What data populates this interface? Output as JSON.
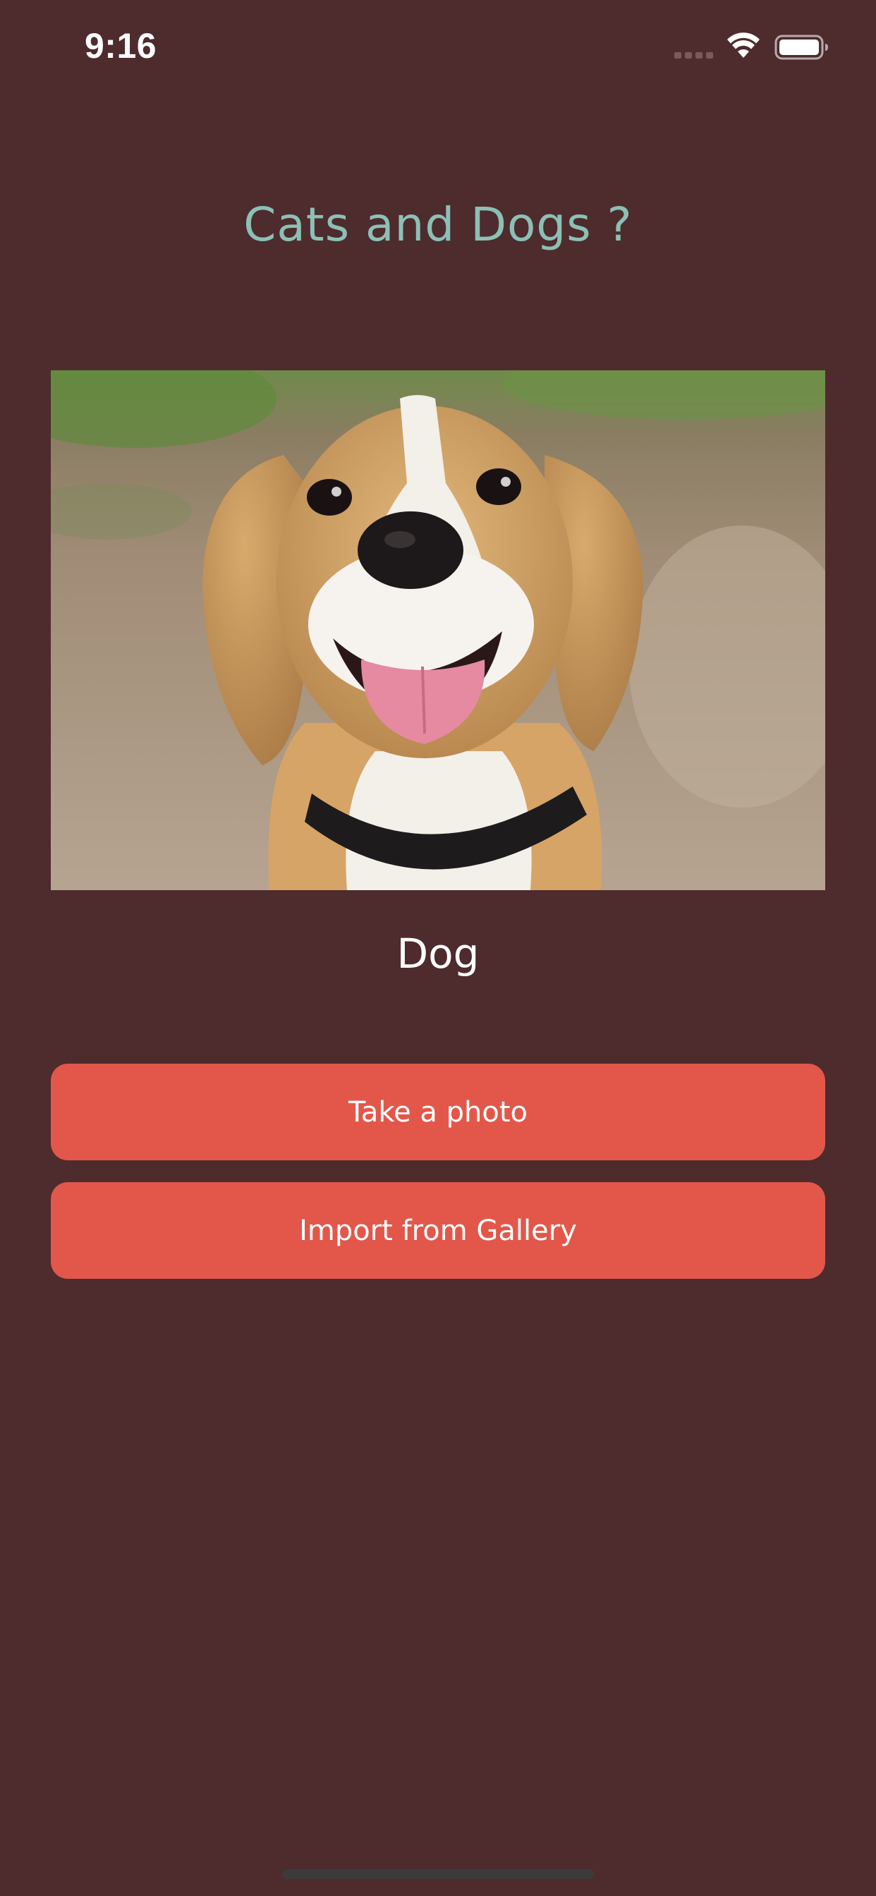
{
  "status_bar": {
    "time": "9:16",
    "signal_icon": "cellular-signal-icon",
    "wifi_icon": "wifi-icon",
    "battery_icon": "battery-icon"
  },
  "main": {
    "title": "Cats and Dogs ?",
    "image": {
      "subject": "beagle-dog-photo"
    },
    "result": "Dog",
    "buttons": {
      "take_photo": "Take a photo",
      "import_gallery": "Import from Gallery"
    }
  },
  "colors": {
    "background": "#4e2b2d",
    "title": "#8cc0b5",
    "button": "#e2574a",
    "button_text": "#ffffff"
  }
}
